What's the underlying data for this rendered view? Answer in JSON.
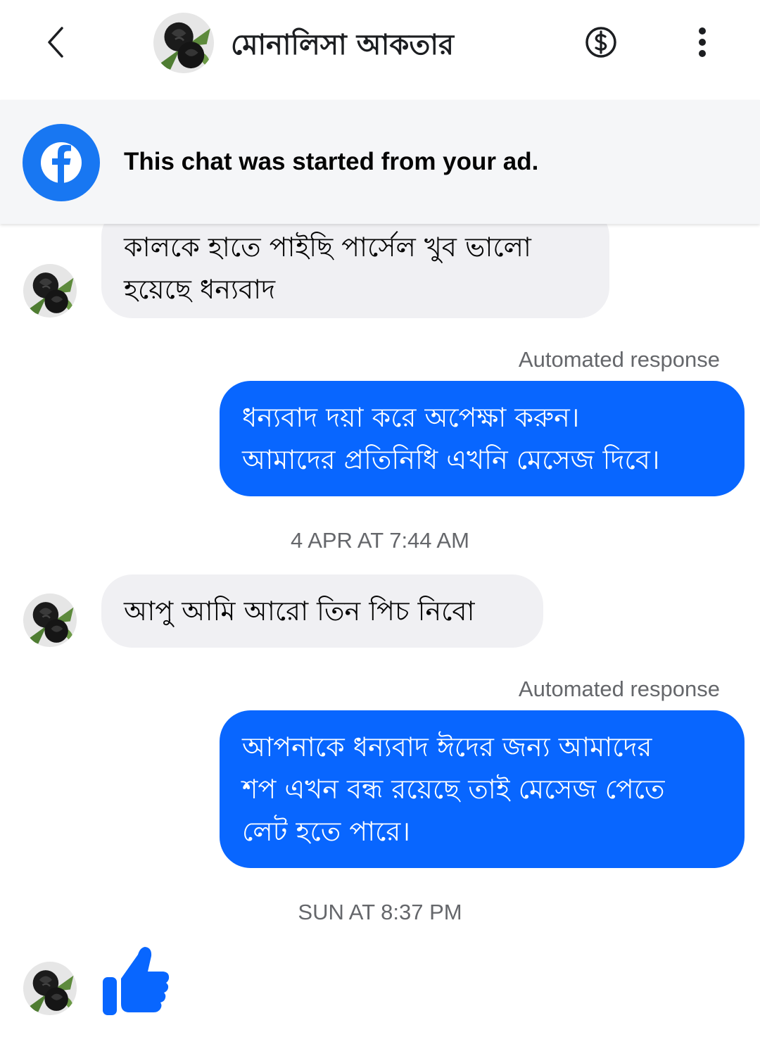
{
  "header": {
    "contact_name": "মোনালিসা আকতার",
    "icons": {
      "back": "chevron-left-icon",
      "payment": "dollar-circle-icon",
      "more": "more-vertical-icon"
    }
  },
  "banner": {
    "text": "This chat was started from your ad.",
    "icon": "facebook-icon"
  },
  "messages": [
    {
      "direction": "incoming",
      "text_lines": [
        "কালকে হাতে পাইছি পার্সেল খুব ভালো",
        "হয়েছে ধন্যবাদ"
      ]
    },
    {
      "direction": "outgoing",
      "label": "Automated response",
      "text_lines": [
        "ধন্যবাদ দয়া করে অপেক্ষা করুন।",
        "আমাদের প্রতিনিধি এখনি মেসেজ দিবে।"
      ]
    },
    {
      "timestamp": "4 APR AT 7:44 AM"
    },
    {
      "direction": "incoming",
      "text_lines": [
        "আপু আমি আরো তিন পিচ নিবো"
      ]
    },
    {
      "direction": "outgoing",
      "label": "Automated response",
      "text_lines": [
        "আপনাকে ধন্যবাদ ঈদের জন্য আমাদের",
        "শপ এখন বন্ধ রয়েছে তাই মেসেজ পেতে",
        "লেট হতে পারে।"
      ]
    },
    {
      "timestamp": "SUN AT 8:37 PM"
    },
    {
      "direction": "incoming",
      "type": "like",
      "icon": "thumbs-up-icon"
    }
  ],
  "colors": {
    "accent": "#0866ff",
    "incoming_bubble": "#f0f0f3",
    "meta_text": "#65676b",
    "banner_bg": "#f5f6f8"
  }
}
